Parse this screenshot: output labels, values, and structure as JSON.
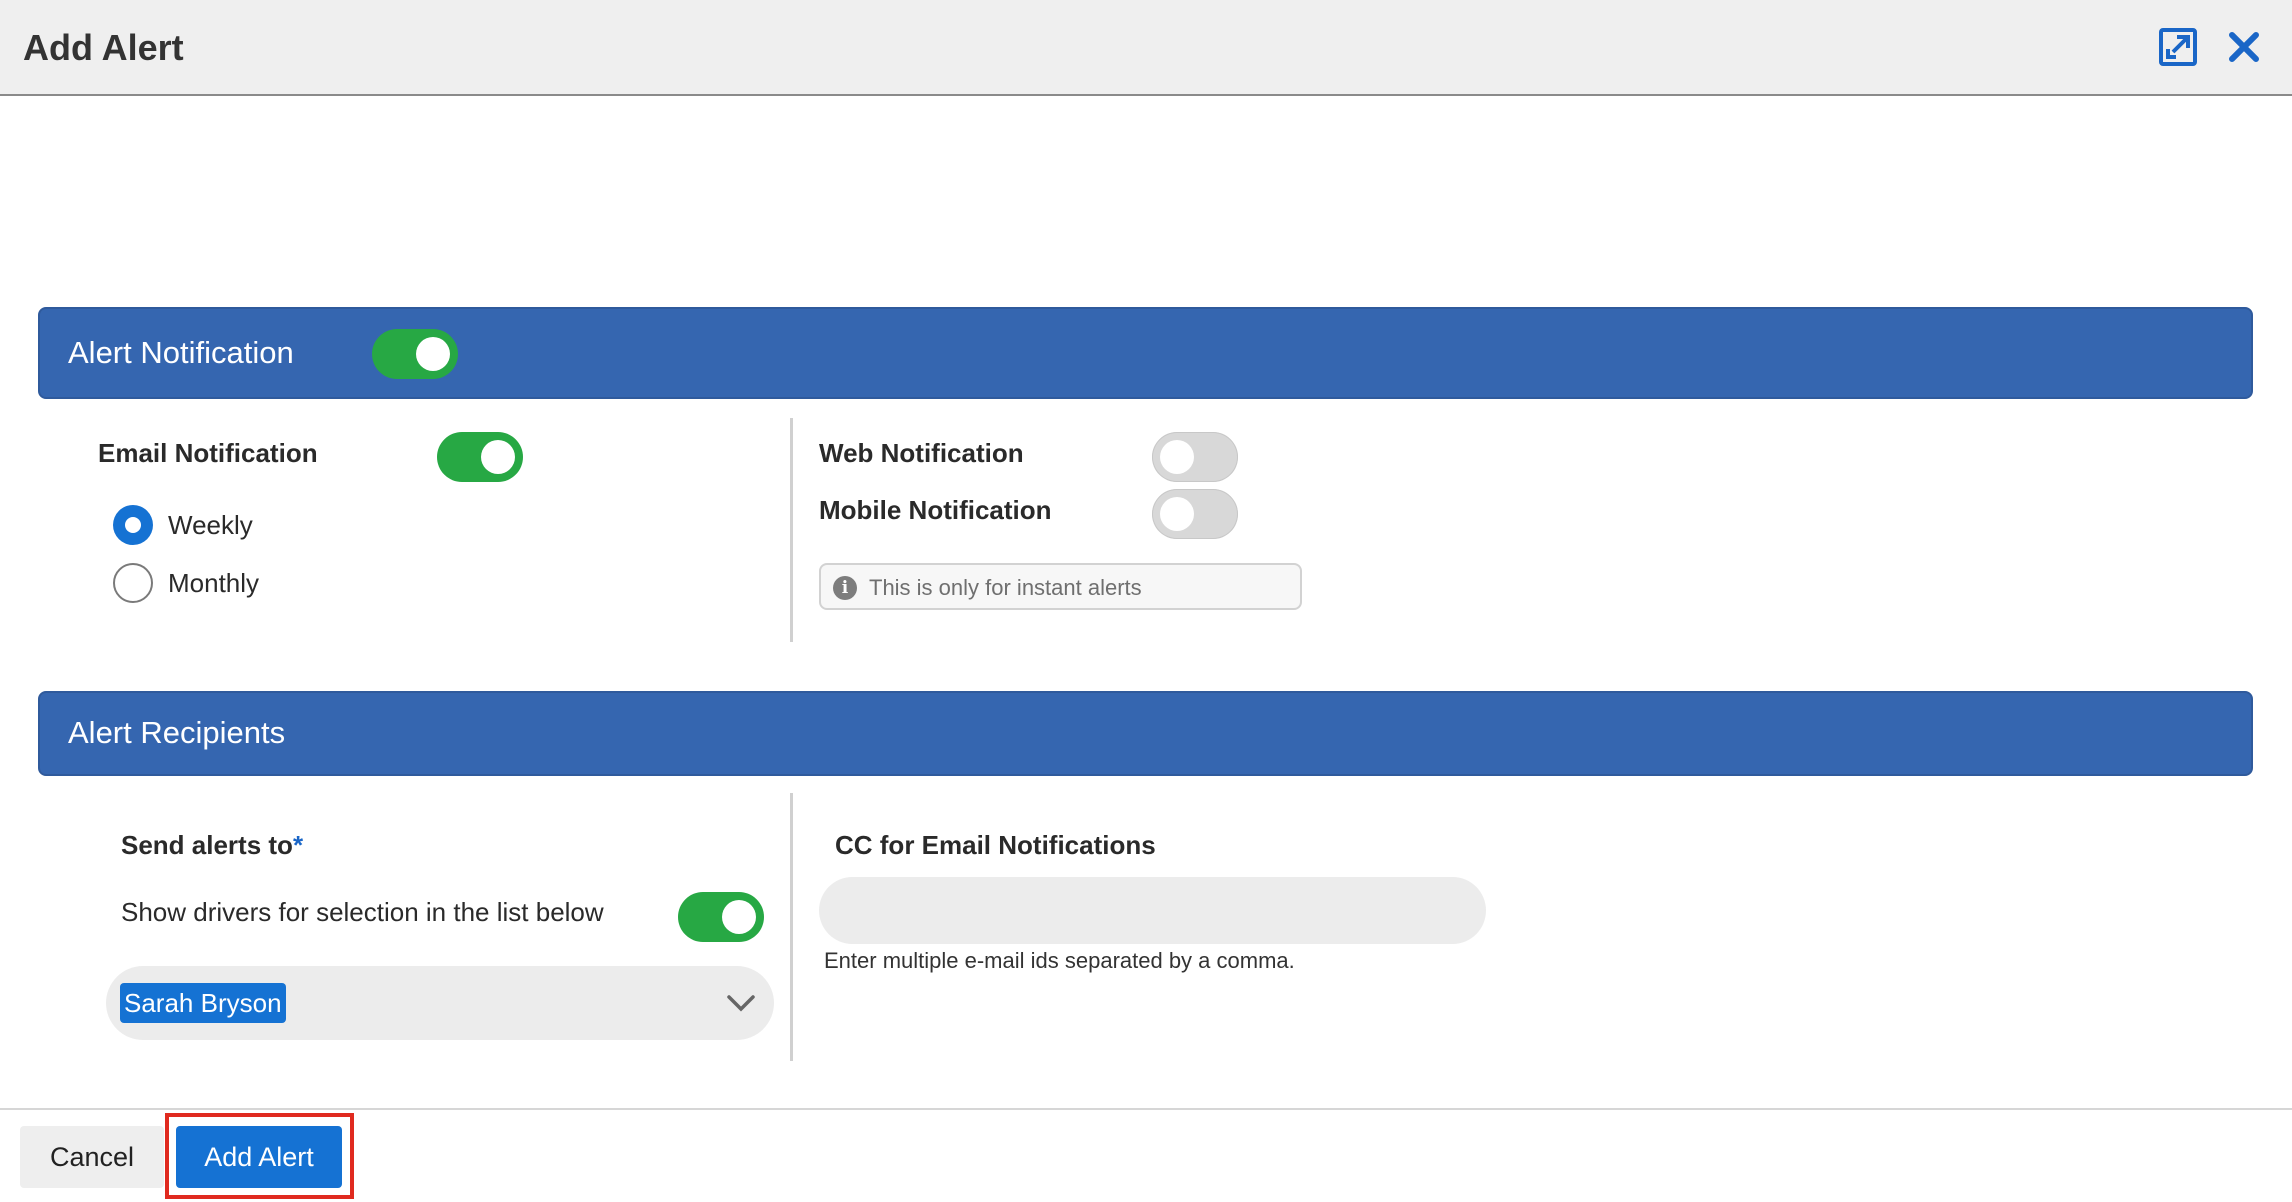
{
  "header": {
    "title": "Add Alert",
    "expand_icon": "expand-icon",
    "close_icon": "close-icon"
  },
  "alert_notification": {
    "title": "Alert Notification",
    "enabled": true,
    "email": {
      "label": "Email Notification",
      "enabled": true,
      "frequency_options": [
        {
          "label": "Weekly",
          "selected": true
        },
        {
          "label": "Monthly",
          "selected": false
        }
      ]
    },
    "web": {
      "label": "Web Notification",
      "enabled": false
    },
    "mobile": {
      "label": "Mobile Notification",
      "enabled": false
    },
    "info_text": "This is only for instant alerts"
  },
  "alert_recipients": {
    "title": "Alert Recipients",
    "send_to_label": "Send alerts to",
    "required_marker": "*",
    "show_drivers_label": "Show drivers for selection in the list below",
    "show_drivers_enabled": true,
    "selected_drivers": [
      "Sarah Bryson"
    ],
    "cc_label": "CC for Email Notifications",
    "cc_value": "",
    "cc_hint": "Enter multiple e-mail ids separated by a comma."
  },
  "footer": {
    "cancel_label": "Cancel",
    "add_label": "Add Alert"
  },
  "colors": {
    "section_bar": "#3566b0",
    "toggle_on": "#27a844",
    "primary": "#1572d3",
    "highlight": "#e02a1f"
  }
}
